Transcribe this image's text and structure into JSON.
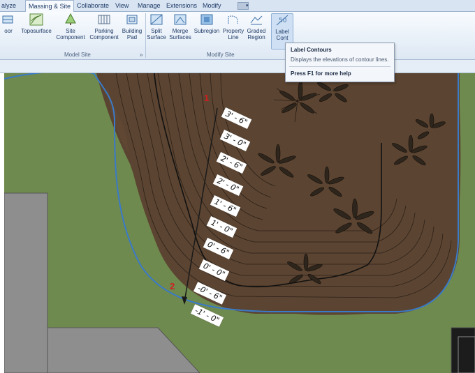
{
  "menu": {
    "tabs": [
      "alyze",
      "Massing & Site",
      "Collaborate",
      "View",
      "Manage",
      "Extensions",
      "Modify"
    ],
    "active_tab": "Massing & Site"
  },
  "ribbon": {
    "model_site": {
      "label": "Model Site",
      "buttons": [
        {
          "line1": "oor",
          "line2": ""
        },
        {
          "line1": "Toposurface",
          "line2": ""
        },
        {
          "line1": "Site",
          "line2": "Component"
        },
        {
          "line1": "Parking",
          "line2": "Component"
        },
        {
          "line1": "Building",
          "line2": "Pad"
        }
      ],
      "expander": "»"
    },
    "modify_site": {
      "label": "Modify Site",
      "buttons": [
        {
          "line1": "Split",
          "line2": "Surface"
        },
        {
          "line1": "Merge",
          "line2": "Surfaces"
        },
        {
          "line1": "Subregion",
          "line2": ""
        },
        {
          "line1": "Property",
          "line2": "Line"
        },
        {
          "line1": "Graded",
          "line2": "Region"
        },
        {
          "line1": "Label",
          "line2": "Cont"
        }
      ]
    }
  },
  "tooltip": {
    "title": "Label Contours",
    "description": "Displays the elevations of contour lines.",
    "help": "Press F1 for more help"
  },
  "canvas": {
    "markers": [
      "1",
      "2"
    ],
    "contour_labels": [
      "3' - 6\"",
      "3' - 0\"",
      "2' - 6\"",
      "2' - 0\"",
      "1' - 6\"",
      "1' - 0\"",
      "0' - 6\"",
      "0' - 0\"",
      "-0' - 6\"",
      "-1' - 0\""
    ]
  },
  "colors": {
    "grass": "#6f8a4e",
    "soil": "#5a4330",
    "boundary": "#3a7ac8",
    "marker": "#d02020"
  }
}
